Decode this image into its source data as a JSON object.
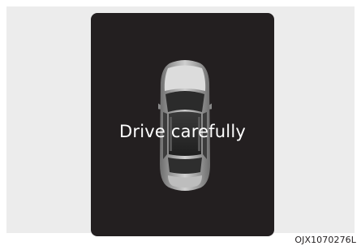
{
  "display": {
    "message": "Drive carefully",
    "vehicle_icon": "car-top-view-icon",
    "background_color": "#231f20",
    "text_color": "#ffffff"
  },
  "figure": {
    "code": "OJX1070276L"
  }
}
